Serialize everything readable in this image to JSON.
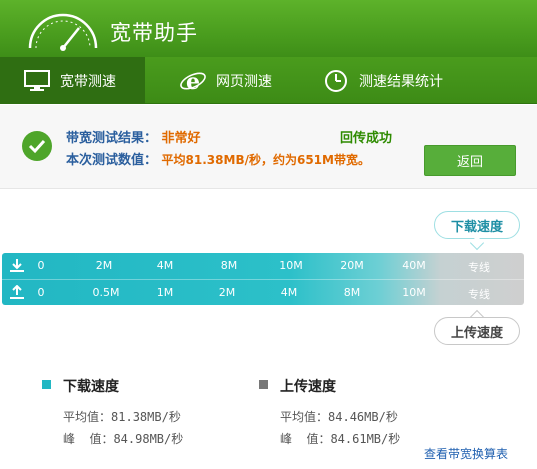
{
  "app": {
    "title": "宽带助手"
  },
  "nav": {
    "tabs": [
      {
        "label": "宽带测速",
        "icon": "monitor-icon",
        "active": true
      },
      {
        "label": "网页测速",
        "icon": "ie-browser-icon",
        "active": false
      },
      {
        "label": "测速结果统计",
        "icon": "clock-icon",
        "active": false
      }
    ]
  },
  "result": {
    "line1_label": "带宽测试结果：",
    "line1_value": "非常好",
    "upload_status": "回传成功",
    "line2_label": "本次测试数值：",
    "line2_value": "平均81.38MB/秒，约为651M带宽。",
    "back_button": "返回"
  },
  "bubbles": {
    "download": "下载速度",
    "upload": "上传速度"
  },
  "scale": {
    "download_ticks": [
      "0",
      "2M",
      "4M",
      "8M",
      "10M",
      "20M",
      "40M",
      "专线"
    ],
    "upload_ticks": [
      "0",
      "0.5M",
      "1M",
      "2M",
      "4M",
      "8M",
      "10M",
      "专线"
    ]
  },
  "stats": {
    "download": {
      "title": "下载速度",
      "avg_label": "平均值：",
      "avg": "81.38MB/秒",
      "peak_label": "峰  值：",
      "peak": "84.98MB/秒"
    },
    "upload": {
      "title": "上传速度",
      "avg_label": "平均值：",
      "avg": "84.46MB/秒",
      "peak_label": "峰  值：",
      "peak": "84.61MB/秒"
    }
  },
  "link": {
    "label": "查看带宽换算表"
  },
  "colors": {
    "brand_green": "#4a9d1e",
    "download_accent": "#22b7c3",
    "upload_accent": "#777777",
    "value_orange": "#e06a00"
  }
}
